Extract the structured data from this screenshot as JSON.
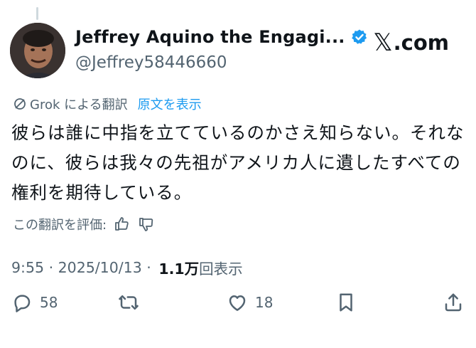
{
  "author": {
    "display_name": "Jeffrey Aquino the Engagi...",
    "handle": "@Jeffrey58446660",
    "verified": true
  },
  "brand": {
    "text": ".com",
    "logo_icon": "x-logo-icon"
  },
  "translation": {
    "label": "Grok による翻訳",
    "original_link": "原文を表示",
    "icon": "translate-icon"
  },
  "tweet": {
    "text": "彼らは誰に中指を立てているのかさえ知らない。それなのに、彼らは我々の先祖がアメリカ人に遺したすべての権利を期待している。"
  },
  "rating": {
    "label": "この翻訳を評価:"
  },
  "meta": {
    "time": "9:55",
    "sep1": " · ",
    "date": "2025/10/13",
    "sep2": " · ",
    "views_count": "1.1万",
    "views_label": "回表示"
  },
  "actions": {
    "reply_count": "58",
    "like_count": "18"
  },
  "colors": {
    "link": "#1d9bf0",
    "secondary": "#536471",
    "text": "#0f1419"
  }
}
